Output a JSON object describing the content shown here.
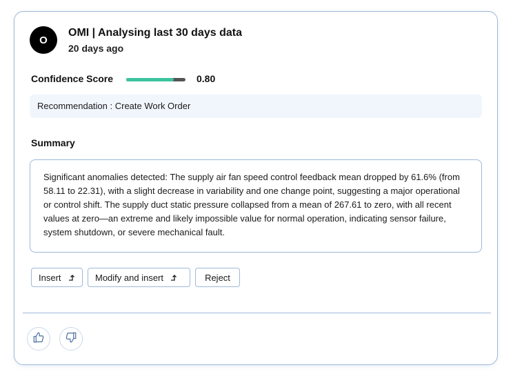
{
  "header": {
    "avatar_letter": "O",
    "title": "OMI | Analysing last 30 days data",
    "time_ago": "20 days ago"
  },
  "confidence": {
    "label": "Confidence Score",
    "value": 0.8,
    "value_text": "0.80",
    "fill_color": "#3cc3a0"
  },
  "recommendation": {
    "text": "Recommendation : Create Work Order"
  },
  "summary": {
    "label": "Summary",
    "text": "Significant anomalies detected: The supply air fan speed control feedback mean dropped by 61.6% (from 58.11 to 22.31), with a slight decrease in variability and one change point, suggesting a major operational or control shift. The supply duct static pressure collapsed from a mean of 267.61 to zero, with all recent values at zero—an extreme and likely impossible value for normal operation, indicating sensor failure, system shutdown, or severe mechanical fault."
  },
  "actions": {
    "insert_label": "Insert",
    "modify_label": "Modify and insert",
    "reject_label": "Reject",
    "insert_icon": "insert-arrow-icon"
  },
  "feedback": {
    "like_icon": "thumbs-up-icon",
    "dislike_icon": "thumbs-down-icon"
  }
}
